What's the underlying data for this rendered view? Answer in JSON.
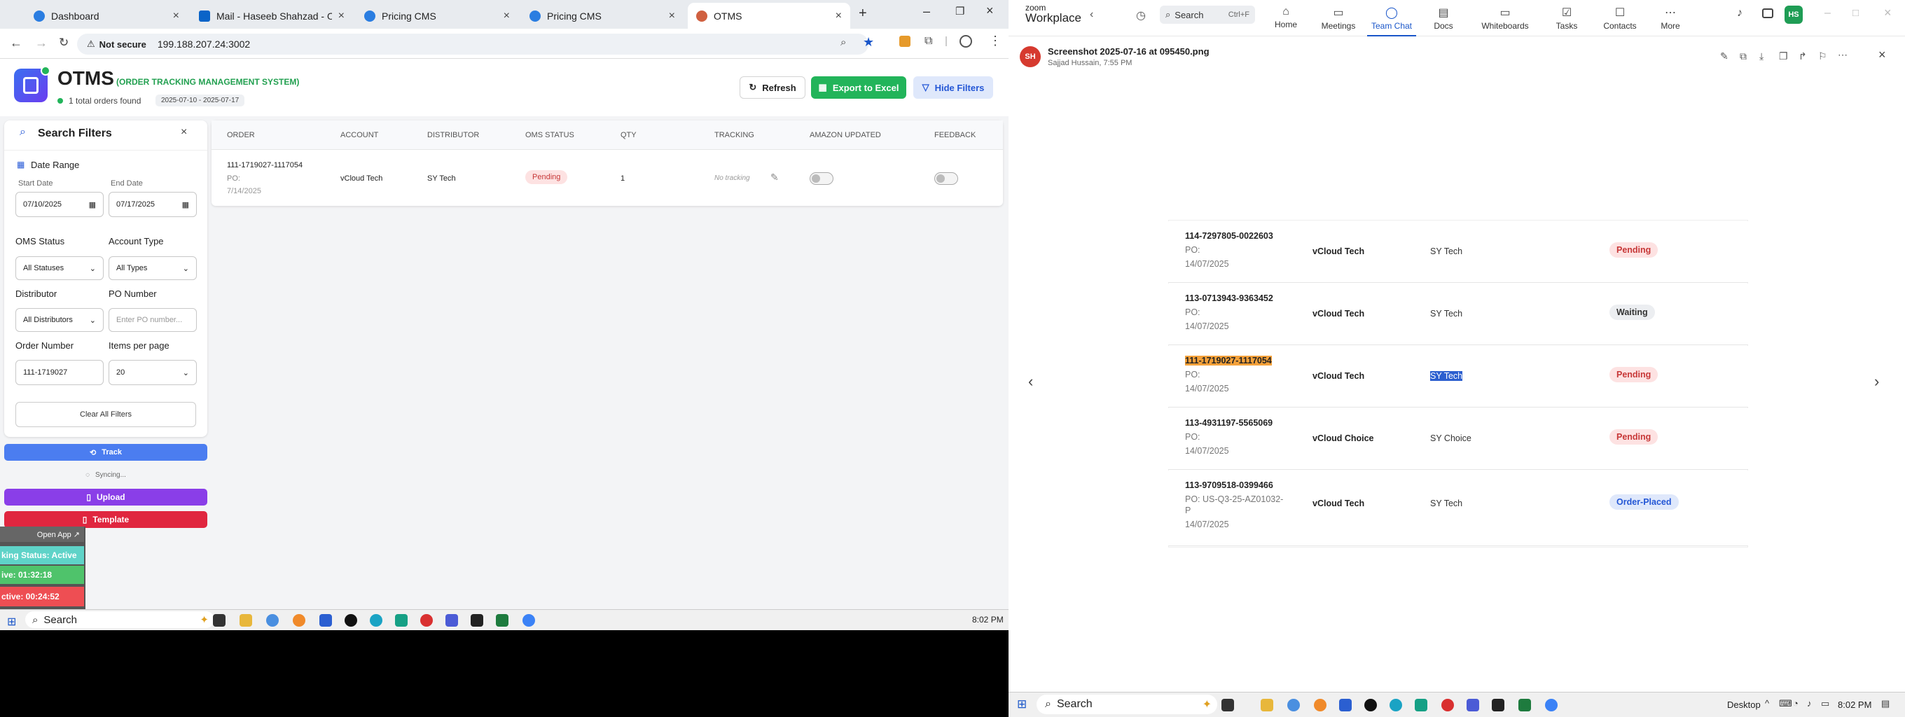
{
  "browser": {
    "tabs": [
      {
        "label": "Dashboard",
        "color": "#2a7de1"
      },
      {
        "label": "Mail - Haseeb Shahzad - Outlo",
        "color": "#0a64c8"
      },
      {
        "label": "Pricing CMS",
        "color": "#2a7de1"
      },
      {
        "label": "Pricing CMS",
        "color": "#2a7de1"
      },
      {
        "label": "OTMS",
        "color": "#d06040"
      }
    ],
    "security": "Not secure",
    "url": "199.188.207.24:3002"
  },
  "app": {
    "title": "OTMS",
    "subtitle": "(ORDER TRACKING MANAGEMENT SYSTEM)",
    "orders_found": "1 total orders found",
    "date_range": "2025-07-10 - 2025-07-17",
    "refresh": "Refresh",
    "export": "Export to Excel",
    "hide_filters": "Hide Filters"
  },
  "filters": {
    "title": "Search Filters",
    "date_range": "Date Range",
    "start_label": "Start Date",
    "start_value": "07/10/2025",
    "end_label": "End Date",
    "end_value": "07/17/2025",
    "oms_status_label": "OMS Status",
    "oms_status_value": "All Statuses",
    "account_type_label": "Account Type",
    "account_type_value": "All Types",
    "distributor_label": "Distributor",
    "distributor_value": "All Distributors",
    "po_label": "PO Number",
    "po_placeholder": "Enter PO number...",
    "order_label": "Order Number",
    "order_value": "111-1719027",
    "ipp_label": "Items per page",
    "ipp_value": "20",
    "clear": "Clear All Filters"
  },
  "actions": {
    "track": "Track",
    "syncing": "Syncing...",
    "upload": "Upload",
    "template": "Template"
  },
  "ext": {
    "open_app": "Open App ↗",
    "status1": "king Status: Active",
    "status2": "ive: 01:32:18",
    "status3": "ctive: 00:24:52"
  },
  "table": {
    "headers": [
      "ORDER",
      "ACCOUNT",
      "DISTRIBUTOR",
      "OMS STATUS",
      "QTY",
      "TRACKING",
      "AMAZON UPDATED",
      "FEEDBACK"
    ],
    "row": {
      "order": "111-1719027-1117054",
      "po": "PO:",
      "date": "7/14/2025",
      "account": "vCloud Tech",
      "distributor": "SY Tech",
      "status": "Pending",
      "qty": "1",
      "tracking": "No tracking"
    }
  },
  "taskbar_left": {
    "search": "Search",
    "time": "8:02 PM"
  },
  "zoom": {
    "brand_top": "zoom",
    "brand": "Workplace",
    "search": "Search",
    "shortcut": "Ctrl+F",
    "nav": [
      {
        "label": "Home",
        "icon": "⌂"
      },
      {
        "label": "Meetings",
        "icon": "▭"
      },
      {
        "label": "Team Chat",
        "icon": "◯"
      },
      {
        "label": "Docs",
        "icon": "▤"
      },
      {
        "label": "Whiteboards",
        "icon": "▭"
      },
      {
        "label": "Tasks",
        "icon": "☑"
      },
      {
        "label": "Contacts",
        "icon": "☐"
      },
      {
        "label": "More",
        "icon": "⋯"
      }
    ],
    "avatar": "HS",
    "file_avatar": "SH",
    "file_title": "Screenshot 2025-07-16 at 095450.png",
    "file_sub": "Sajjad Hussain, 7:55 PM"
  },
  "zrows": [
    {
      "order": "114-7297805-0022603",
      "po": "PO:",
      "date": "14/07/2025",
      "account": "vCloud Tech",
      "dist": "SY Tech",
      "status": "Pending"
    },
    {
      "order": "113-0713943-9363452",
      "po": "PO:",
      "date": "14/07/2025",
      "account": "vCloud Tech",
      "dist": "SY Tech",
      "status": "Waiting"
    },
    {
      "order": "111-1719027-1117054",
      "po": "PO:",
      "date": "14/07/2025",
      "account": "vCloud Tech",
      "dist": "SY Tech",
      "status": "Pending"
    },
    {
      "order": "113-4931197-5565069",
      "po": "PO:",
      "date": "14/07/2025",
      "account": "vCloud Choice",
      "dist": "SY Choice",
      "status": "Pending"
    },
    {
      "order": "113-9709518-0399466",
      "po": "PO: US-Q3-25-AZ01032-",
      "po2": "P",
      "date": "14/07/2025",
      "account": "vCloud Tech",
      "dist": "SY Tech",
      "status": "Order-Placed"
    }
  ],
  "taskbar_right": {
    "search": "Search",
    "desktop": "Desktop",
    "time": "8:02 PM"
  }
}
